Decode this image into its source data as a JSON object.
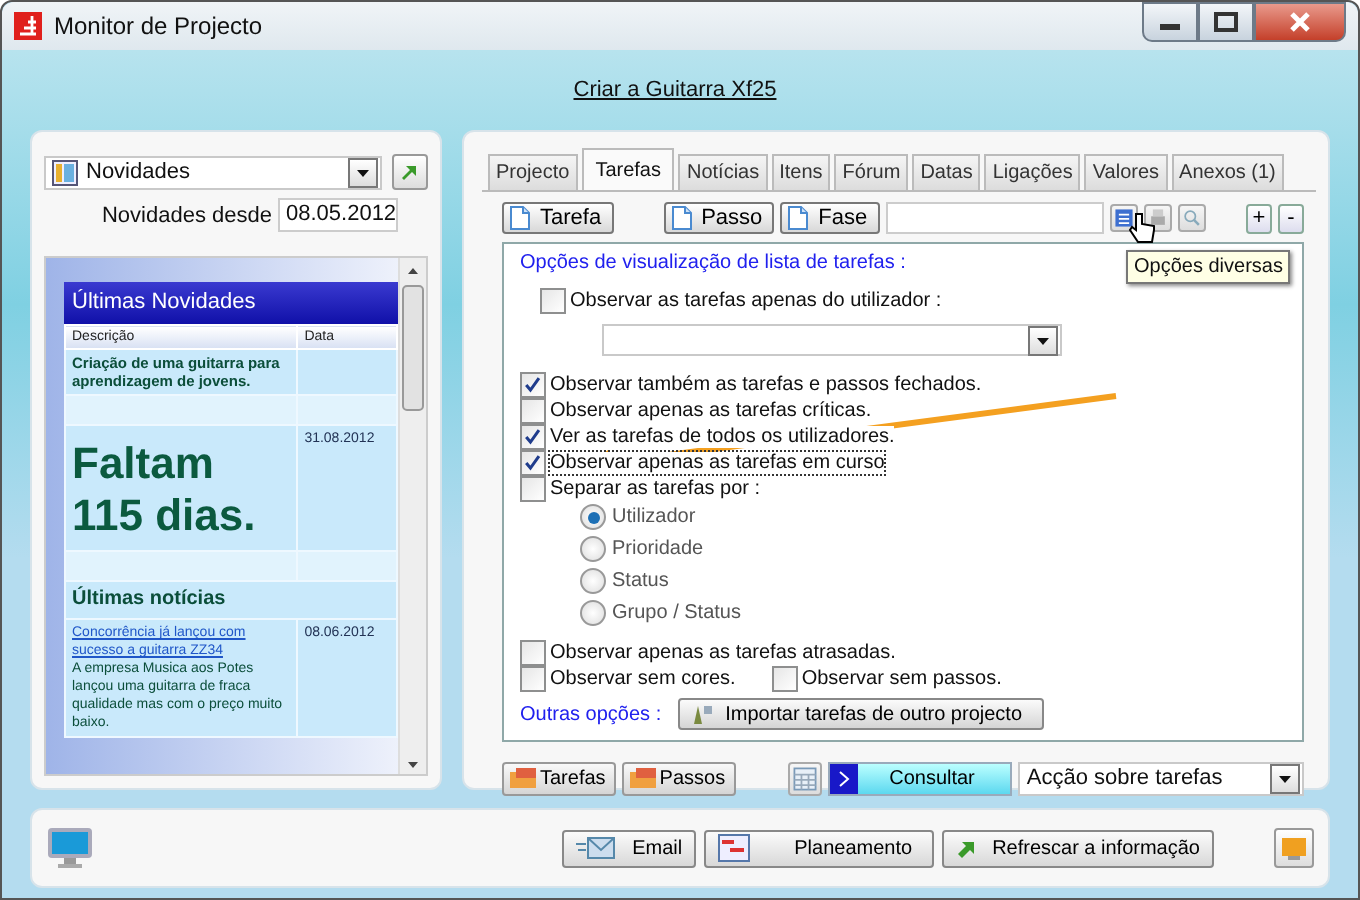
{
  "window": {
    "title": "Monitor de Projecto"
  },
  "header_link": "Criar a Guitarra Xf25",
  "left": {
    "selector": {
      "value": "Novidades"
    },
    "since": {
      "label": "Novidades desde",
      "value": "08.05.2012"
    },
    "news": {
      "title": "Últimas Novidades",
      "columns": [
        "Descrição",
        "Data"
      ],
      "rows": [
        {
          "kind": "bold",
          "text": "Criação de uma guitarra para aprendizagem de jovens."
        },
        {
          "kind": "spacer"
        },
        {
          "kind": "big",
          "text": "Faltam 115 dias.",
          "date": "31.08.2012"
        },
        {
          "kind": "spacer"
        },
        {
          "kind": "heading",
          "text": "Últimas notícias"
        },
        {
          "kind": "news",
          "link": "Concorrência já lançou com sucesso a guitarra ZZ34",
          "text": "A empresa Musica aos Potes lançou uma guitarra de fraca qualidade mas com o preço muito baixo.",
          "date": "08.06.2012"
        }
      ]
    }
  },
  "tabs": [
    {
      "label": "Projecto",
      "selected": false
    },
    {
      "label": "Tarefas",
      "selected": true
    },
    {
      "label": "Notícias",
      "selected": false
    },
    {
      "label": "Itens",
      "selected": false
    },
    {
      "label": "Fórum",
      "selected": false
    },
    {
      "label": "Datas",
      "selected": false
    },
    {
      "label": "Ligações",
      "selected": false
    },
    {
      "label": "Valores",
      "selected": false
    },
    {
      "label": "Anexos (1)",
      "selected": false
    }
  ],
  "toolbar": {
    "new_buttons": [
      "Tarefa",
      "Passo",
      "Fase"
    ],
    "zoom_in": "+",
    "zoom_out": "-"
  },
  "tooltip": "Opções diversas",
  "options": {
    "title": "Opções de visualização de lista de tarefas :",
    "user_filter": {
      "label": "Observar as tarefas apenas do utilizador :",
      "checked": false
    },
    "checks": [
      {
        "label": "Observar também as tarefas e passos fechados.",
        "checked": true,
        "focused": false
      },
      {
        "label": "Observar apenas as tarefas críticas.",
        "checked": false,
        "focused": false
      },
      {
        "label": "Ver as tarefas de todos os utilizadores.",
        "checked": true,
        "focused": false
      },
      {
        "label": "Observar apenas as tarefas em curso",
        "checked": true,
        "focused": true
      }
    ],
    "separate": {
      "label": "Separar as tarefas por :",
      "checked": false
    },
    "radios": [
      {
        "label": "Utilizador",
        "selected": true
      },
      {
        "label": "Prioridade",
        "selected": false
      },
      {
        "label": "Status",
        "selected": false
      },
      {
        "label": "Grupo / Status",
        "selected": false
      }
    ],
    "late": {
      "label": "Observar apenas as tarefas atrasadas.",
      "checked": false
    },
    "no_colors": {
      "label": "Observar sem cores.",
      "checked": false
    },
    "no_steps": {
      "label": "Observar sem passos.",
      "checked": false
    },
    "other_label": "Outras opções :",
    "import_button": "Importar tarefas de outro projecto"
  },
  "bottom": {
    "buttons": [
      "Tarefas",
      "Passos"
    ],
    "query_button": "Consultar",
    "action": "Acção sobre tarefas"
  },
  "footer": {
    "buttons": [
      "Email",
      "Planeamento",
      "Refrescar a informação"
    ]
  }
}
